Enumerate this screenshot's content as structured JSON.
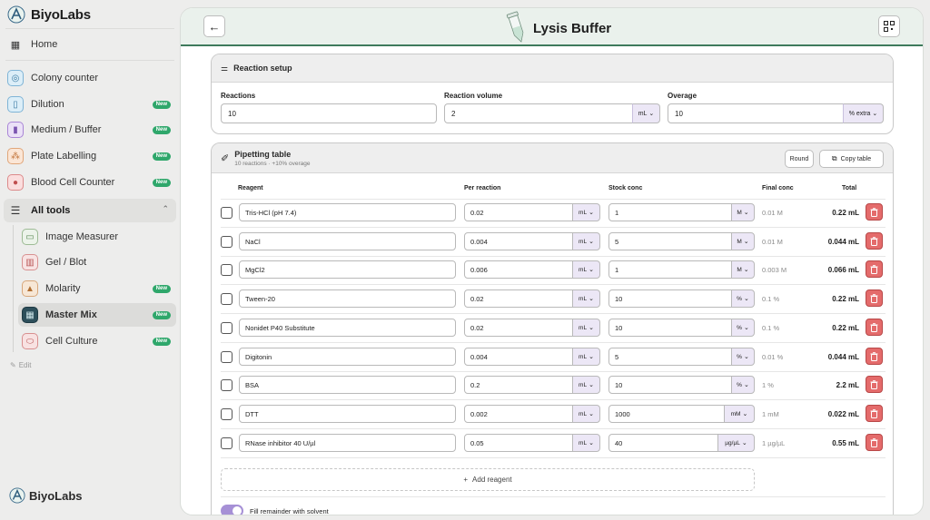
{
  "brand": {
    "name": "BiyoLabs"
  },
  "sidebar": {
    "home": "Home",
    "items": [
      {
        "label": "Colony counter",
        "icon": "colony-icon",
        "new": ""
      },
      {
        "label": "Dilution",
        "icon": "dilution-icon",
        "new": "New"
      },
      {
        "label": "Medium / Buffer",
        "icon": "bottle-icon",
        "new": "New"
      },
      {
        "label": "Plate Labelling",
        "icon": "plate-icon",
        "new": "New"
      },
      {
        "label": "Blood Cell Counter",
        "icon": "blood-cell-icon",
        "new": "New"
      }
    ],
    "all_tools": "All tools",
    "tools": [
      {
        "label": "Image Measurer",
        "icon": "image-measurer-icon",
        "new": ""
      },
      {
        "label": "Gel / Blot",
        "icon": "gel-icon",
        "new": ""
      },
      {
        "label": "Molarity",
        "icon": "molarity-icon",
        "new": "New"
      },
      {
        "label": "Master Mix",
        "icon": "master-mix-icon",
        "new": "New"
      },
      {
        "label": "Cell Culture",
        "icon": "cell-culture-icon",
        "new": "New"
      }
    ],
    "edit": "Edit"
  },
  "header": {
    "title": "Lysis Buffer"
  },
  "setup": {
    "title": "Reaction setup",
    "reactions_label": "Reactions",
    "reactions_value": "10",
    "volume_label": "Reaction volume",
    "volume_value": "2",
    "volume_unit": "mL",
    "overage_label": "Overage",
    "overage_value": "10",
    "overage_unit": "% extra"
  },
  "pipetting": {
    "title": "Pipetting table",
    "subtitle": "10 reactions · +10% overage",
    "round_label": "Round",
    "copy_label": "Copy table",
    "headers": {
      "reagent": "Reagent",
      "per_reaction": "Per reaction",
      "stock": "Stock conc",
      "final": "Final conc",
      "total": "Total"
    },
    "rows": [
      {
        "reagent": "Tris-HCl (pH 7.4)",
        "per": "0.02",
        "per_unit": "mL",
        "stock": "1",
        "stock_unit": "M",
        "final": "0.01 M",
        "total": "0.22 mL"
      },
      {
        "reagent": "NaCl",
        "per": "0.004",
        "per_unit": "mL",
        "stock": "5",
        "stock_unit": "M",
        "final": "0.01 M",
        "total": "0.044 mL"
      },
      {
        "reagent": "MgCl2",
        "per": "0.006",
        "per_unit": "mL",
        "stock": "1",
        "stock_unit": "M",
        "final": "0.003 M",
        "total": "0.066 mL"
      },
      {
        "reagent": "Tween-20",
        "per": "0.02",
        "per_unit": "mL",
        "stock": "10",
        "stock_unit": "%",
        "final": "0.1 %",
        "total": "0.22 mL"
      },
      {
        "reagent": "Nonidet P40 Substitute",
        "per": "0.02",
        "per_unit": "mL",
        "stock": "10",
        "stock_unit": "%",
        "final": "0.1 %",
        "total": "0.22 mL"
      },
      {
        "reagent": "Digitonin",
        "per": "0.004",
        "per_unit": "mL",
        "stock": "5",
        "stock_unit": "%",
        "final": "0.01 %",
        "total": "0.044 mL"
      },
      {
        "reagent": "BSA",
        "per": "0.2",
        "per_unit": "mL",
        "stock": "10",
        "stock_unit": "%",
        "final": "1 %",
        "total": "2.2 mL"
      },
      {
        "reagent": "DTT",
        "per": "0.002",
        "per_unit": "mL",
        "stock": "1000",
        "stock_unit": "mM",
        "final": "1 mM",
        "total": "0.022 mL"
      },
      {
        "reagent": "RNase inhibitor 40 U/µl",
        "per": "0.05",
        "per_unit": "mL",
        "stock": "40",
        "stock_unit": "µg/µL",
        "final": "1 µg/µL",
        "total": "0.55 mL"
      }
    ],
    "add_reagent": "Add reagent",
    "fill_remainder": "Fill remainder with solvent"
  },
  "colors": {
    "accent": "#3e7a5c",
    "unit_bg": "#ece7f6",
    "new_badge": "#2fa76b",
    "delete": "#e46b6b"
  }
}
